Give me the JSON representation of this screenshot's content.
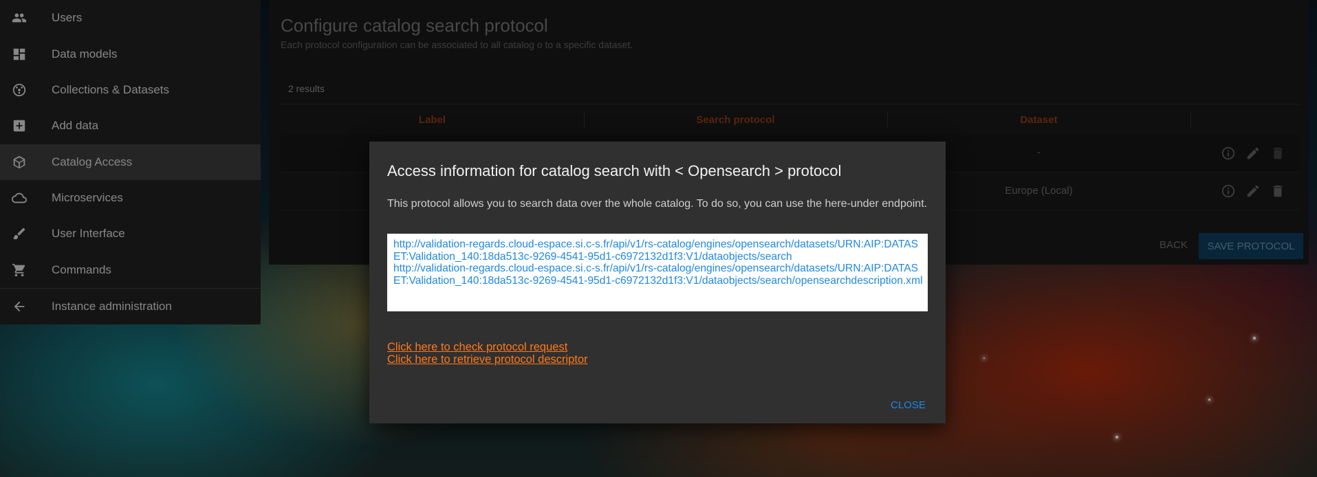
{
  "sidebar": {
    "items": [
      {
        "label": "Users",
        "icon": "users-icon"
      },
      {
        "label": "Data models",
        "icon": "dashboard-icon"
      },
      {
        "label": "Collections & Datasets",
        "icon": "collections-icon"
      },
      {
        "label": "Add data",
        "icon": "add-box-icon"
      },
      {
        "label": "Catalog Access",
        "icon": "cube-icon",
        "active": true
      },
      {
        "label": "Microservices",
        "icon": "cloud-icon"
      },
      {
        "label": "User Interface",
        "icon": "brush-icon"
      },
      {
        "label": "Commands",
        "icon": "cart-icon"
      },
      {
        "label": "Instance administration",
        "icon": "arrow-back-icon"
      }
    ]
  },
  "main": {
    "title": "Configure catalog search protocol",
    "subtitle": "Each protocol configuration can be associated to all catalog o to a specific dataset.",
    "results": "2 results",
    "columns": [
      "Label",
      "Search protocol",
      "Dataset"
    ],
    "rows": [
      {
        "dataset": "-"
      },
      {
        "dataset": "Europe (Local)"
      }
    ],
    "back_label": "BACK",
    "save_label": "SAVE PROTOCOL"
  },
  "dialog": {
    "title": "Access information for catalog search with < Opensearch > protocol",
    "text": "This protocol allows you to search data over the whole catalog. To do so, you can use the here-under endpoint.",
    "url_1": "http://validation-regards.cloud-espace.si.c-s.fr/api/v1/rs-catalog/engines/opensearch/datasets/URN:AIP:DATASET:Validation_140:18da513c-9269-4541-95d1-c6972132d1f3:V1/dataobjects/search",
    "url_2": "http://validation-regards.cloud-espace.si.c-s.fr/api/v1/rs-catalog/engines/opensearch/datasets/URN:AIP:DATASET:Validation_140:18da513c-9269-4541-95d1-c6972132d1f3:V1/dataobjects/search/opensearchdescription.xml",
    "link_check": "Click here to check protocol request",
    "link_descriptor": "Click here to retrieve protocol descriptor",
    "close_label": "CLOSE"
  },
  "colors": {
    "accent_orange": "#ff7a1a",
    "link_blue": "#1e88e5",
    "header_text": "#8a3a14"
  }
}
